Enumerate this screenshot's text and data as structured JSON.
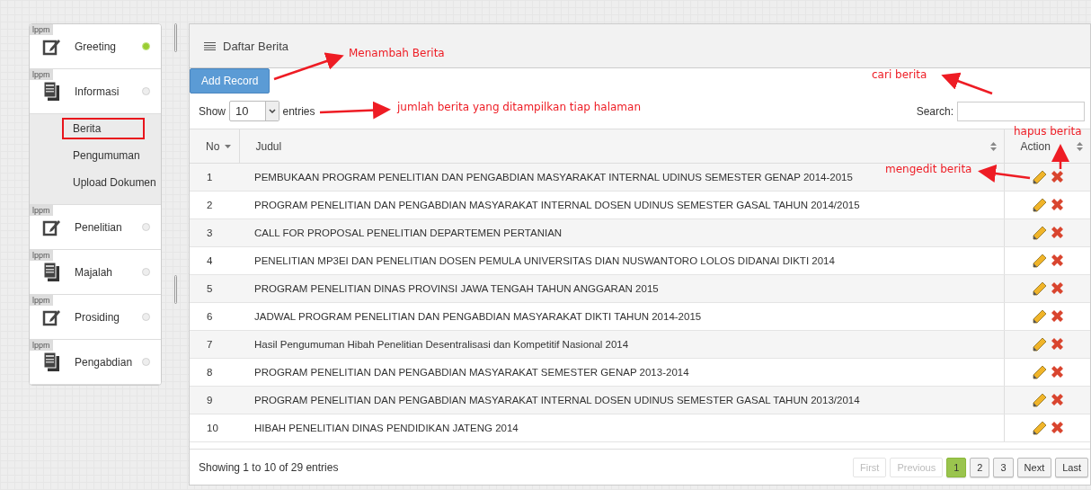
{
  "sidebar": {
    "items": [
      {
        "badge": "lppm",
        "label": "Greeting",
        "kind": "edit",
        "active": true
      },
      {
        "badge": "lppm",
        "label": "Informasi",
        "kind": "doc",
        "active": false,
        "children": [
          {
            "label": "Berita",
            "selected": true
          },
          {
            "label": "Pengumuman",
            "selected": false
          },
          {
            "label": "Upload Dokumen",
            "selected": false
          }
        ]
      },
      {
        "badge": "lppm",
        "label": "Penelitian",
        "kind": "edit",
        "active": false
      },
      {
        "badge": "lppm",
        "label": "Majalah",
        "kind": "doc",
        "active": false
      },
      {
        "badge": "lppm",
        "label": "Prosiding",
        "kind": "edit",
        "active": false
      },
      {
        "badge": "lppm",
        "label": "Pengabdian",
        "kind": "doc",
        "active": false
      }
    ]
  },
  "panel": {
    "title": "Daftar Berita",
    "add_button": "Add Record",
    "length": {
      "before": "Show",
      "value": "10",
      "after": "entries"
    },
    "search": {
      "label": "Search:"
    },
    "table": {
      "columns": [
        {
          "label": "No",
          "sorted": true
        },
        {
          "label": "Judul",
          "sorted": false
        },
        {
          "label": "Action",
          "sorted": false
        }
      ],
      "rows": [
        {
          "no": "1",
          "title": "PEMBUKAAN PROGRAM PENELITIAN DAN PENGABDIAN MASYARAKAT INTERNAL UDINUS SEMESTER GENAP 2014-2015"
        },
        {
          "no": "2",
          "title": "PROGRAM PENELITIAN DAN PENGABDIAN MASYARAKAT INTERNAL DOSEN UDINUS SEMESTER GASAL TAHUN 2014/2015"
        },
        {
          "no": "3",
          "title": "CALL FOR PROPOSAL PENELITIAN DEPARTEMEN PERTANIAN"
        },
        {
          "no": "4",
          "title": "PENELITIAN MP3EI DAN PENELITIAN DOSEN PEMULA UNIVERSITAS DIAN NUSWANTORO LOLOS DIDANAI DIKTI 2014"
        },
        {
          "no": "5",
          "title": "PROGRAM PENELITIAN DINAS PROVINSI JAWA TENGAH TAHUN ANGGARAN 2015"
        },
        {
          "no": "6",
          "title": "JADWAL PROGRAM PENELITIAN DAN PENGABDIAN MASYARAKAT DIKTI TAHUN 2014-2015"
        },
        {
          "no": "7",
          "title": "Hasil Pengumuman Hibah Penelitian Desentralisasi dan Kompetitif Nasional 2014"
        },
        {
          "no": "8",
          "title": "PROGRAM PENELITIAN DAN PENGABDIAN MASYARAKAT SEMESTER GENAP 2013-2014"
        },
        {
          "no": "9",
          "title": "PROGRAM PENELITIAN DAN PENGABDIAN MASYARAKAT INTERNAL DOSEN UDINUS SEMESTER GASAL TAHUN 2013/2014"
        },
        {
          "no": "10",
          "title": "HIBAH PENELITIAN DINAS PENDIDIKAN JATENG 2014"
        }
      ]
    },
    "info": "Showing 1 to 10 of 29 entries",
    "pagination": [
      {
        "label": "First",
        "disabled": true,
        "selected": false
      },
      {
        "label": "Previous",
        "disabled": true,
        "selected": false
      },
      {
        "label": "1",
        "disabled": false,
        "selected": true
      },
      {
        "label": "2",
        "disabled": false,
        "selected": false
      },
      {
        "label": "3",
        "disabled": false,
        "selected": false
      },
      {
        "label": "Next",
        "disabled": false,
        "selected": false
      },
      {
        "label": "Last",
        "disabled": false,
        "selected": false
      }
    ]
  },
  "annotations": [
    {
      "text": "Menambah Berita",
      "kind": "add"
    },
    {
      "text": "cari berita",
      "kind": "search"
    },
    {
      "text": "jumlah berita yang ditampilkan tiap halaman",
      "kind": "length"
    },
    {
      "text": "hapus berita",
      "kind": "delete"
    },
    {
      "text": "mengedit berita",
      "kind": "edit"
    }
  ]
}
